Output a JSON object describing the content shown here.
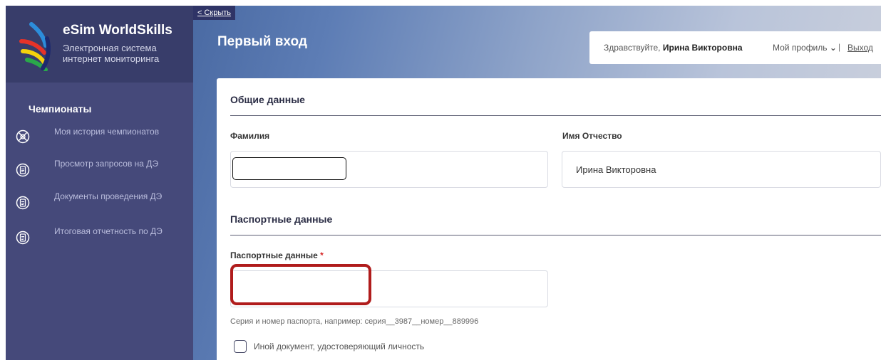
{
  "sidebar": {
    "brand_title": "eSim WorldSkills",
    "brand_subtitle": "Электронная система интернет мониторинга",
    "section_title": "Чемпионаты",
    "items": [
      {
        "label": "Моя история чемпионатов",
        "icon": "compass-icon"
      },
      {
        "label": "Просмотр запросов на ДЭ",
        "icon": "document-icon"
      },
      {
        "label": "Документы проведения ДЭ",
        "icon": "document-icon"
      },
      {
        "label": "Итоговая отчетность по ДЭ",
        "icon": "document-icon"
      }
    ]
  },
  "header": {
    "hide_link": "< Скрыть",
    "page_title": "Первый вход",
    "greeting_prefix": "Здравствуйте,",
    "user_name": "Ирина Викторовна",
    "profile_label": "Мой профиль",
    "separator": "|",
    "logout_label": "Выход"
  },
  "form": {
    "general_section": "Общие данные",
    "surname_label": "Фамилия",
    "surname_value": "",
    "name_label": "Имя Отчество",
    "name_value": "Ирина Викторовна",
    "passport_section": "Паспортные данные",
    "passport_label": "Паспортные данные",
    "required_mark": "*",
    "passport_value": "",
    "passport_hint": "Серия и номер паспорта, например: серия__3987__номер__889996",
    "other_document_label": "Иной документ, удостоверяющий личность",
    "other_document_checked": false
  },
  "colors": {
    "sidebar_bg": "#45497a",
    "brand_bg": "#383d6a",
    "highlight": "#b01c1c",
    "required": "#d62828"
  }
}
